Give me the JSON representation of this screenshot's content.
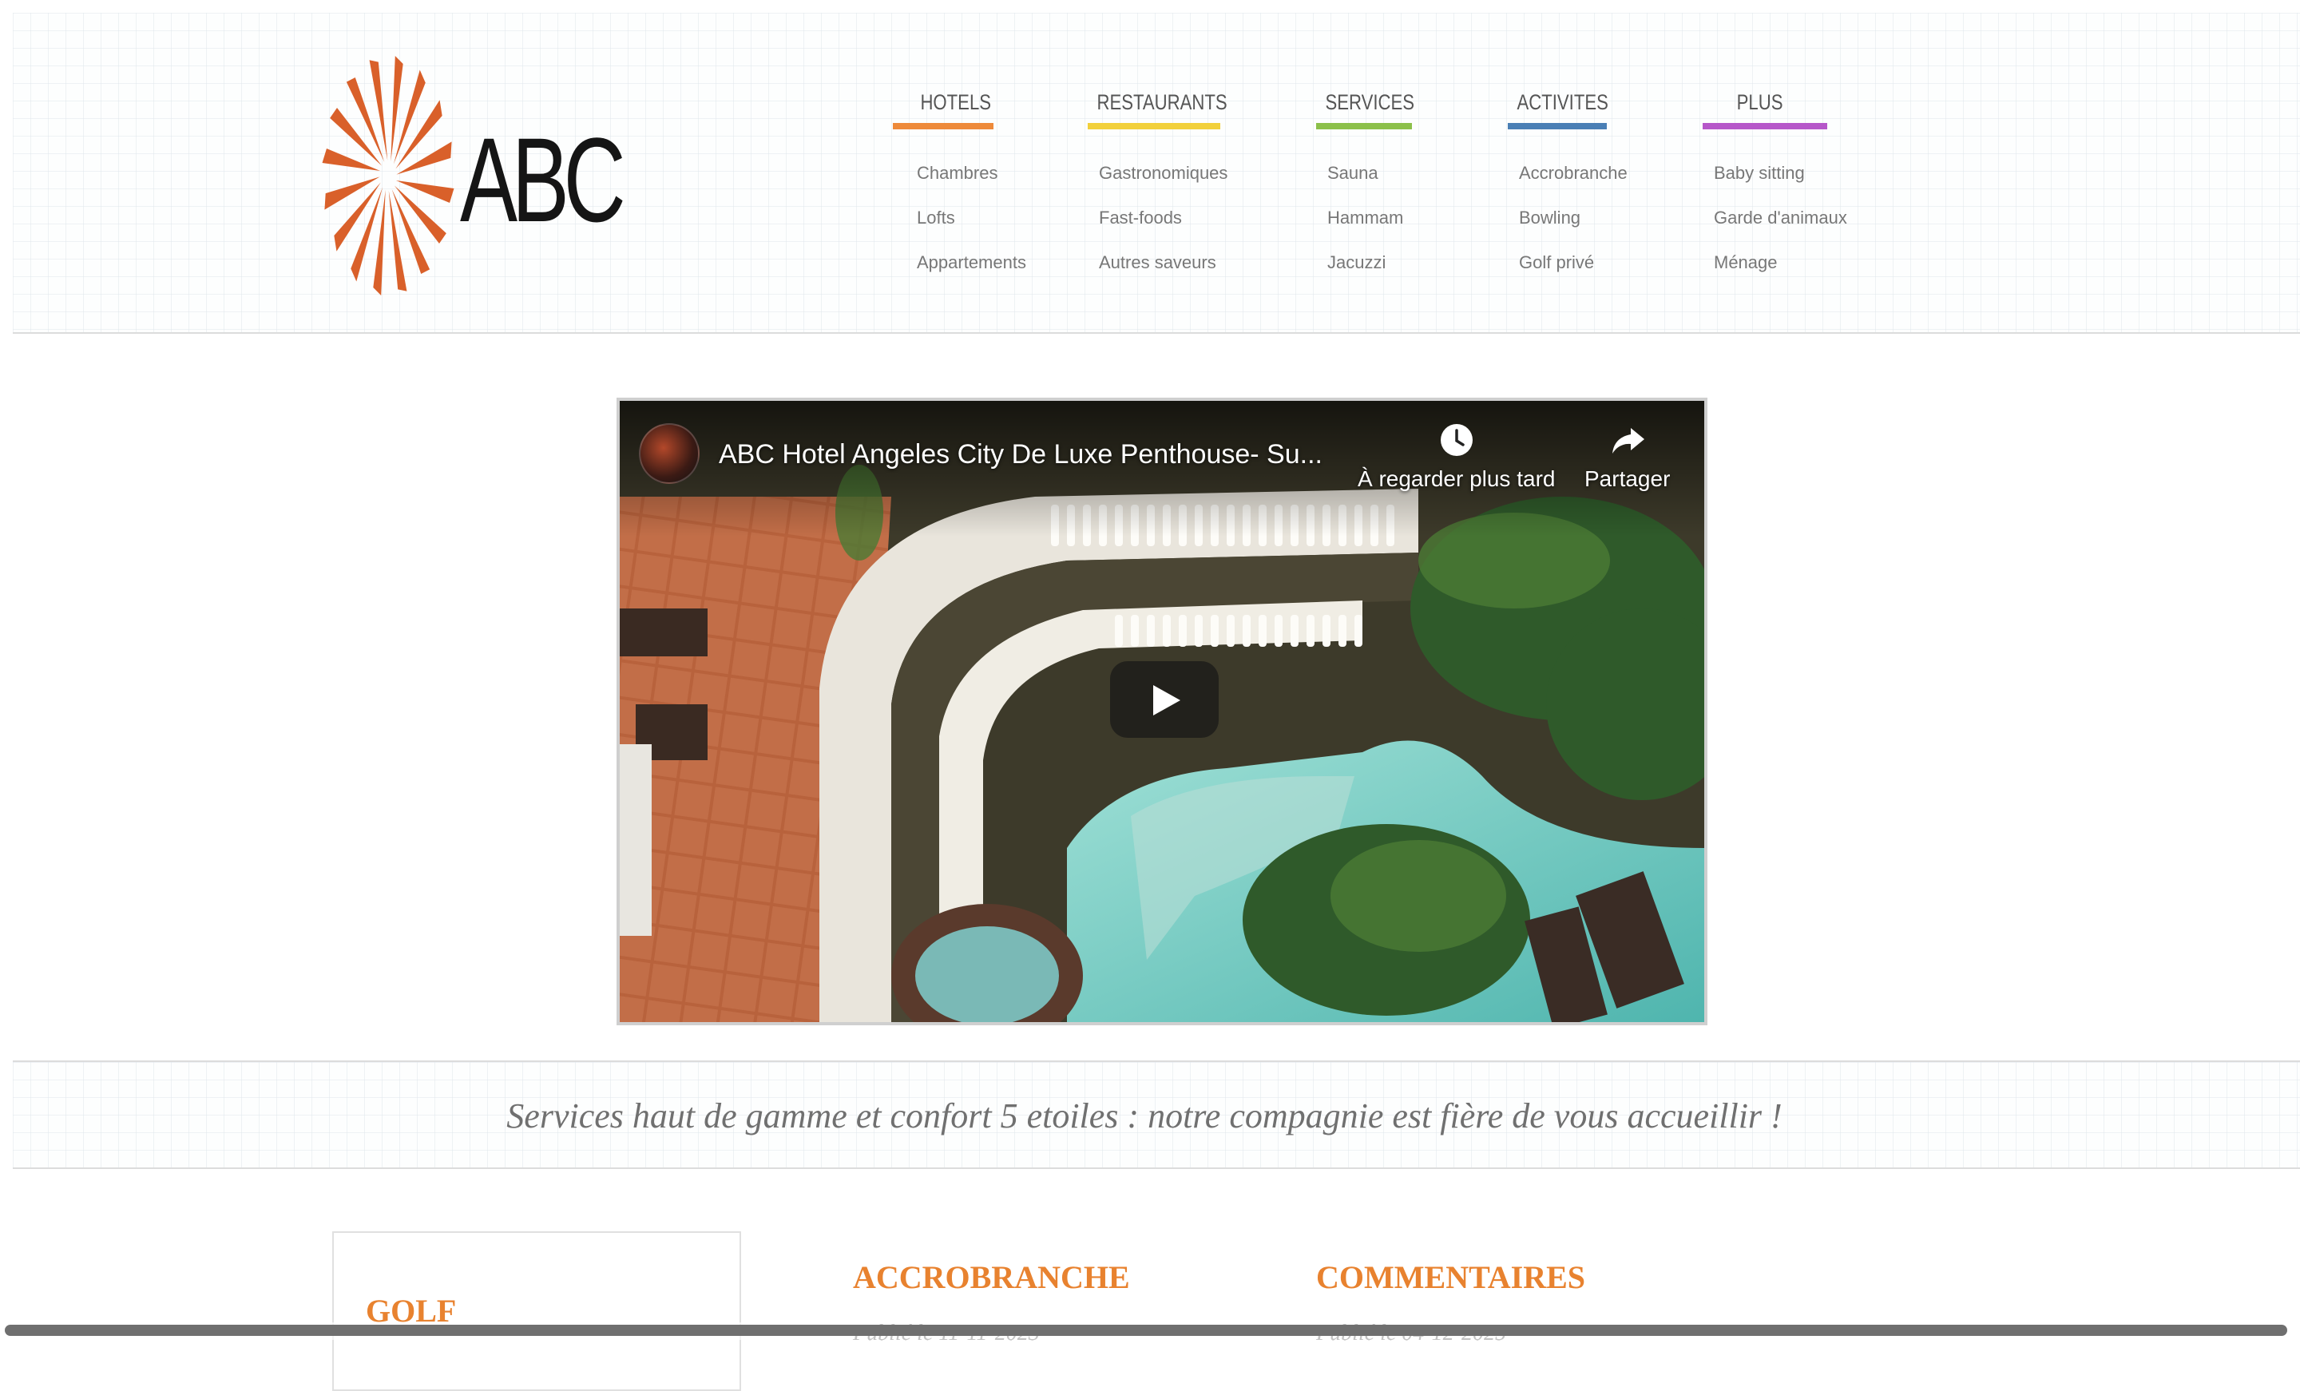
{
  "brand": {
    "logo_text": "ABC",
    "logo_color": "#d9602a"
  },
  "nav": [
    {
      "title": "HOTELS",
      "color": "#ee8a3a",
      "items": [
        "Chambres",
        "Lofts",
        "Appartements"
      ]
    },
    {
      "title": "RESTAURANTS",
      "color": "#f2d03b",
      "items": [
        "Gastronomiques",
        "Fast-foods",
        "Autres saveurs"
      ]
    },
    {
      "title": "SERVICES",
      "color": "#8cc04a",
      "items": [
        "Sauna",
        "Hammam",
        "Jacuzzi"
      ]
    },
    {
      "title": "ACTIVITES",
      "color": "#4a7fb5",
      "items": [
        "Accrobranche",
        "Bowling",
        "Golf privé"
      ]
    },
    {
      "title": "PLUS",
      "color": "#b657c9",
      "items": [
        "Baby sitting",
        "Garde d'animaux",
        "Ménage"
      ]
    }
  ],
  "video": {
    "title": "ABC Hotel Angeles City De Luxe Penthouse- Su...",
    "watch_later_label": "À regarder plus tard",
    "share_label": "Partager",
    "icons": {
      "watch_later": "clock-icon",
      "share": "share-arrow-icon",
      "play": "play-icon"
    }
  },
  "tagline": "Services haut de gamme et confort 5 etoiles : notre compagnie est fière de vous accueillir !",
  "articles": {
    "golf": {
      "title": "GOLF"
    },
    "accrobranche": {
      "title": "ACCROBRANCHE",
      "date": "Publié le 11-11-2023"
    },
    "commentaires": {
      "title": "COMMENTAIRES",
      "date": "Publié le 04-12-2025"
    }
  },
  "colors": {
    "accent": "#e8822f",
    "tagline": "#707070"
  }
}
